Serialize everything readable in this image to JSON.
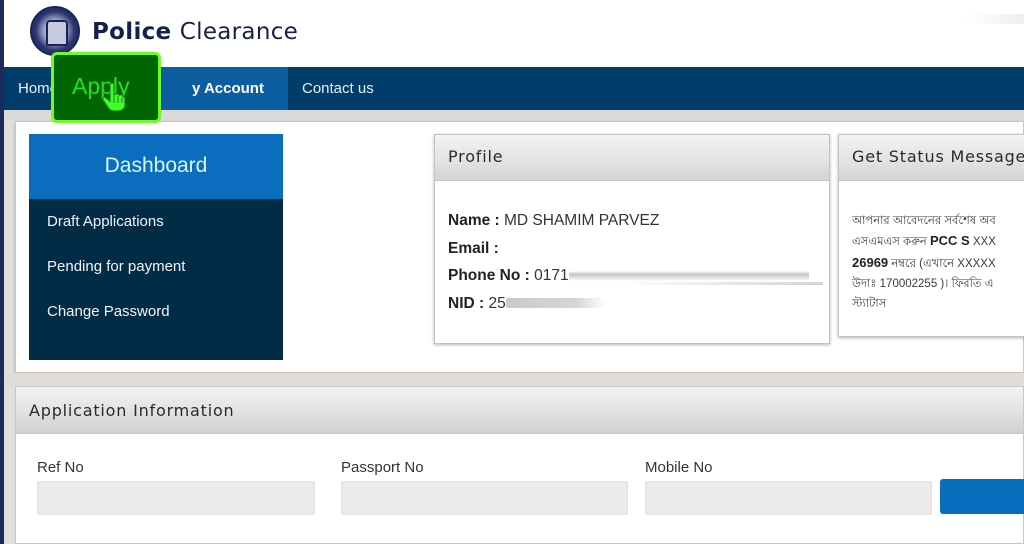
{
  "header": {
    "logo_icon": "police-emblem-icon",
    "title_bold": "Police",
    "title_light": "Clearance"
  },
  "nav": {
    "items": [
      {
        "label": "Home",
        "visible_text": "Hom"
      },
      {
        "label": "Apply"
      },
      {
        "label": "My Account",
        "visible_text": "y Account",
        "active": true
      },
      {
        "label": "Contact us"
      }
    ],
    "highlight": {
      "label": "Apply",
      "icon": "hand-pointer-icon",
      "color": "#23e01e",
      "background": "#006400",
      "border": "#6dfb2a"
    }
  },
  "dashboard": {
    "title": "Dashboard",
    "items": [
      {
        "label": "Draft Applications"
      },
      {
        "label": "Pending for payment"
      },
      {
        "label": "Change Password"
      }
    ]
  },
  "profile": {
    "title": "Profile",
    "name_label": "Name :",
    "name_value": "MD SHAMIM PARVEZ",
    "email_label": "Email :",
    "email_value": "",
    "phone_label": "Phone No :",
    "phone_value": "0171",
    "nid_label": "NID :",
    "nid_value": "25"
  },
  "status_message": {
    "title": "Get Status Message",
    "lines": [
      {
        "text": "আপনার আবেদনের সর্বশেষ অব"
      },
      {
        "pre": "এসএমএস করুন ",
        "bold": "PCC S",
        "post": " XXX"
      },
      {
        "bold": "26969",
        "post": " নম্বরে (এখানে XXXXX"
      },
      {
        "text": "উদাঃ 170002255 )। ফিরতি এ"
      },
      {
        "text": "স্ট্যাটাস"
      }
    ]
  },
  "application_info": {
    "title": "Application Information",
    "fields": [
      {
        "label": "Ref No",
        "value": "",
        "placeholder": ""
      },
      {
        "label": "Passport No",
        "value": "",
        "placeholder": ""
      },
      {
        "label": "Mobile No",
        "value": "",
        "placeholder": ""
      }
    ],
    "search_button_label": ""
  },
  "colors": {
    "nav_bg": "#003d6b",
    "nav_active": "#0b5fa0",
    "dashboard_head": "#0a6dbd",
    "dashboard_body": "#022b46",
    "title_color": "#16204f",
    "button_blue": "#076ebe"
  }
}
